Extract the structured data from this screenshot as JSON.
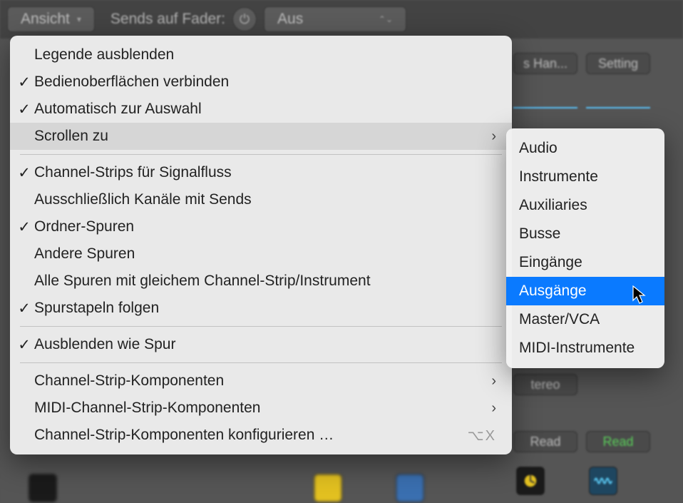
{
  "toolbar": {
    "view_button": "Ansicht",
    "sends_label": "Sends auf Fader:",
    "dropdown_value": "Aus"
  },
  "background": {
    "chip_1": "s Han...",
    "chip_2": "Setting",
    "chip_stereo": "tereo",
    "chip_read_1": "Read",
    "chip_read_2": "Read"
  },
  "menu": {
    "items": [
      {
        "label": "Legende ausblenden",
        "checked": false,
        "submenu": false
      },
      {
        "label": "Bedienoberflächen verbinden",
        "checked": true,
        "submenu": false
      },
      {
        "label": "Automatisch zur Auswahl",
        "checked": true,
        "submenu": false
      },
      {
        "label": "Scrollen zu",
        "checked": false,
        "submenu": true,
        "highlight": true
      },
      {
        "separator": true
      },
      {
        "label": "Channel-Strips für Signalfluss",
        "checked": true,
        "submenu": false
      },
      {
        "label": "Ausschließlich Kanäle mit Sends",
        "checked": false,
        "submenu": false
      },
      {
        "label": "Ordner-Spuren",
        "checked": true,
        "submenu": false
      },
      {
        "label": "Andere Spuren",
        "checked": false,
        "submenu": false
      },
      {
        "label": "Alle Spuren mit gleichem Channel-Strip/Instrument",
        "checked": false,
        "submenu": false
      },
      {
        "label": "Spurstapeln folgen",
        "checked": true,
        "submenu": false
      },
      {
        "separator": true
      },
      {
        "label": "Ausblenden wie Spur",
        "checked": true,
        "submenu": false
      },
      {
        "separator": true
      },
      {
        "label": "Channel-Strip-Komponenten",
        "checked": false,
        "submenu": true
      },
      {
        "label": "MIDI-Channel-Strip-Komponenten",
        "checked": false,
        "submenu": true
      },
      {
        "label": "Channel-Strip-Komponenten konfigurieren …",
        "checked": false,
        "submenu": false,
        "shortcut": "⌥X"
      }
    ]
  },
  "submenu": {
    "items": [
      {
        "label": "Audio"
      },
      {
        "label": "Instrumente"
      },
      {
        "label": "Auxiliaries"
      },
      {
        "label": "Busse"
      },
      {
        "label": "Eingänge"
      },
      {
        "label": "Ausgänge",
        "selected": true
      },
      {
        "label": "Master/VCA"
      },
      {
        "label": "MIDI-Instrumente"
      }
    ]
  }
}
